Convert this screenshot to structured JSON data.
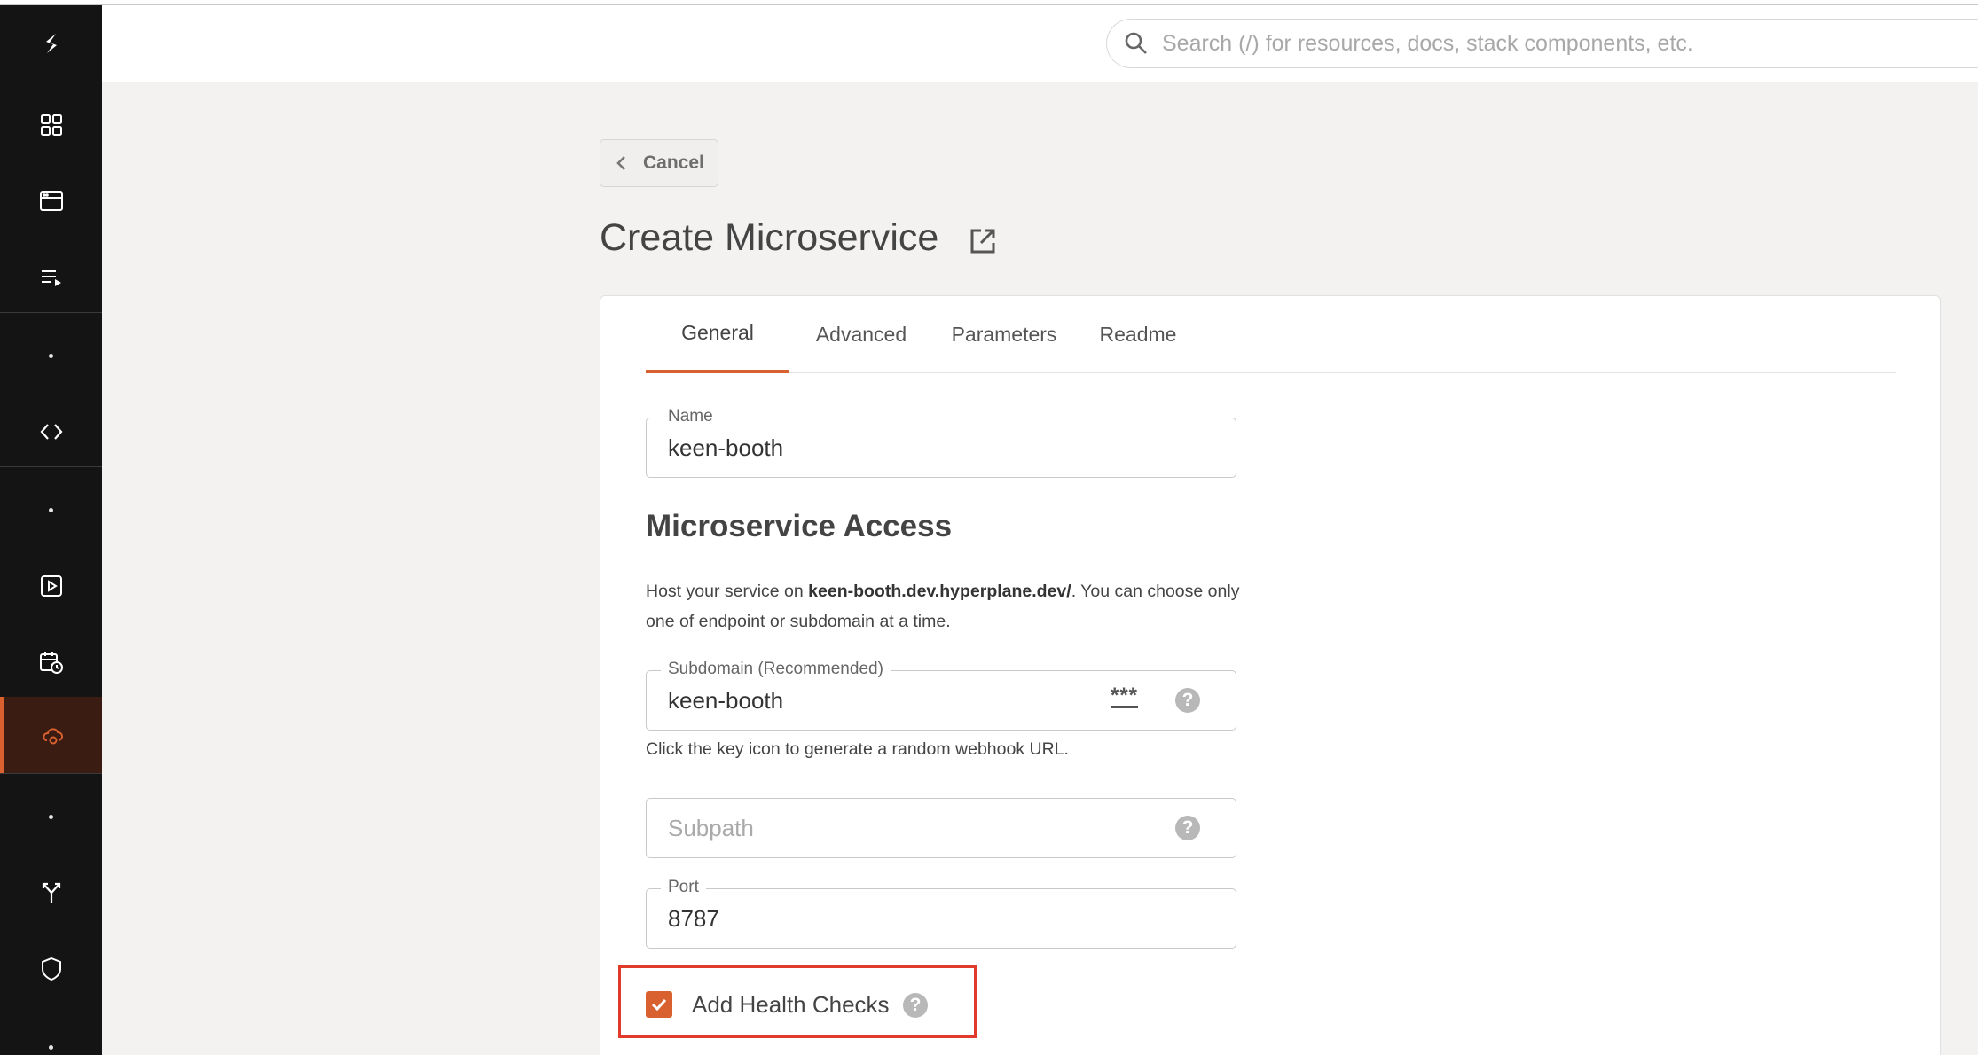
{
  "header": {
    "search_placeholder": "Search (/) for resources, docs, stack components, etc."
  },
  "sidebar": {
    "items": [
      {
        "icon": "logo-icon"
      },
      {
        "icon": "dashboard-grid-icon"
      },
      {
        "icon": "browser-window-icon"
      },
      {
        "icon": "playlist-icon"
      },
      {
        "icon": "dot"
      },
      {
        "icon": "code-icon"
      },
      {
        "icon": "dot"
      },
      {
        "icon": "play-square-icon"
      },
      {
        "icon": "calendar-clock-icon"
      },
      {
        "icon": "cloud-gear-icon",
        "active": true
      },
      {
        "icon": "dot"
      },
      {
        "icon": "fork-icon"
      },
      {
        "icon": "shield-icon"
      },
      {
        "icon": "dot"
      }
    ],
    "accent": "#d9602f"
  },
  "page": {
    "cancel_label": "Cancel",
    "title": "Create Microservice"
  },
  "tabs": [
    {
      "label": "General",
      "active": true
    },
    {
      "label": "Advanced",
      "active": false
    },
    {
      "label": "Parameters",
      "active": false
    },
    {
      "label": "Readme",
      "active": false
    }
  ],
  "form": {
    "name": {
      "label": "Name",
      "value": "keen-booth"
    },
    "section_title": "Microservice Access",
    "desc_prefix": "Host your service on ",
    "desc_host": "keen-booth.dev.hyperplane.dev/",
    "desc_suffix": ". You can choose only one of endpoint or subdomain at a time.",
    "subdomain": {
      "label": "Subdomain (Recommended)",
      "value": "keen-booth",
      "key_icon_text": "***"
    },
    "subdomain_hint": "Click the key icon to generate a random webhook URL.",
    "subpath": {
      "placeholder": "Subpath"
    },
    "port": {
      "label": "Port",
      "value": "8787"
    },
    "health_checks": {
      "label": "Add Health Checks",
      "checked": true
    },
    "help_glyph": "?"
  }
}
